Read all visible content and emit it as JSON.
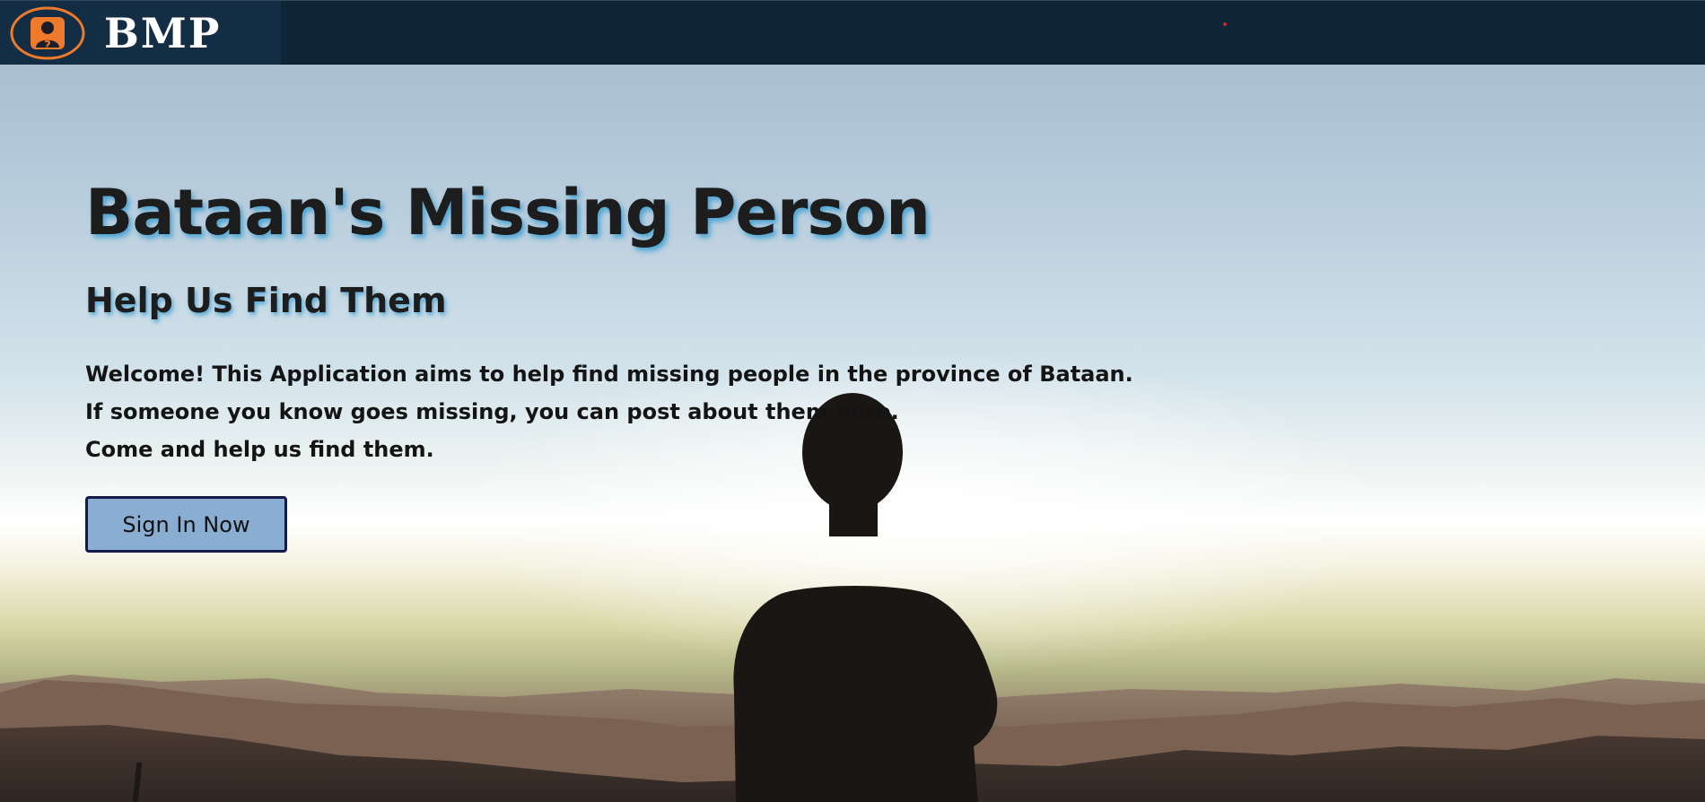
{
  "navbar": {
    "brand_text": "BMP",
    "logo_icon": "missing-person-icon",
    "accent_color": "#f07a2b"
  },
  "hero": {
    "title": "Bataan's Missing Person",
    "subtitle": "Help Us Find Them",
    "description": [
      "Welcome! This Application aims to help find missing people in the province of Bataan.",
      "If someone you know goes missing, you can post about them here.",
      "Come and help us find them."
    ],
    "cta_label": "Sign In Now",
    "background_image": "silhouette-person-sunset-mountains"
  },
  "colors": {
    "navbar_bg": "#0e2538",
    "brand_bg": "#132d44",
    "button_bg": "#8aaed2",
    "button_border": "#151a4a",
    "title_shadow": "#2896d2"
  }
}
